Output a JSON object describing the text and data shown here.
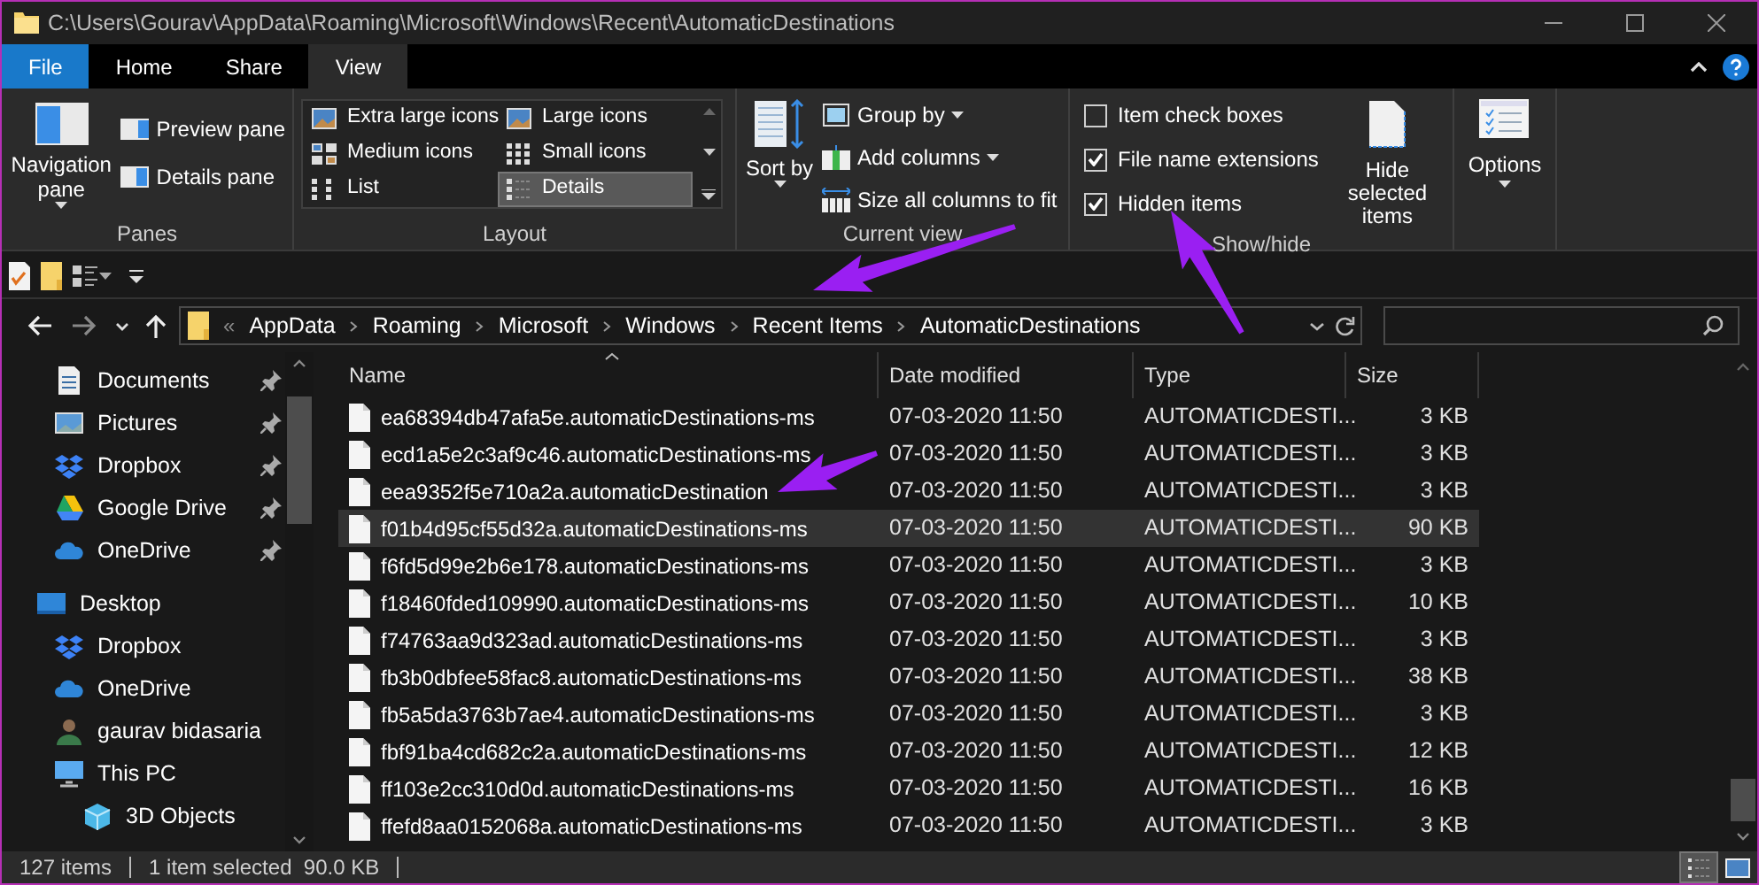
{
  "window": {
    "title": "C:\\Users\\Gourav\\AppData\\Roaming\\Microsoft\\Windows\\Recent\\AutomaticDestinations"
  },
  "tabs": [
    {
      "label": "File",
      "kind": "file",
      "selected": false
    },
    {
      "label": "Home",
      "kind": "tab",
      "selected": false
    },
    {
      "label": "Share",
      "kind": "tab",
      "selected": false
    },
    {
      "label": "View",
      "kind": "tab",
      "selected": true
    }
  ],
  "ribbon": {
    "panes": {
      "label": "Panes",
      "navigation_pane": "Navigation pane",
      "buttons": [
        "Preview pane",
        "Details pane"
      ]
    },
    "layout": {
      "label": "Layout",
      "options": [
        {
          "label": "Extra large icons",
          "kind": "xl",
          "selected": false
        },
        {
          "label": "Large icons",
          "kind": "large",
          "selected": false
        },
        {
          "label": "Medium icons",
          "kind": "medium",
          "selected": false
        },
        {
          "label": "Small icons",
          "kind": "small",
          "selected": false
        },
        {
          "label": "List",
          "kind": "list",
          "selected": false
        },
        {
          "label": "Details",
          "kind": "details",
          "selected": true
        }
      ]
    },
    "current_view": {
      "label": "Current view",
      "sort_by": "Sort by",
      "buttons": [
        {
          "label": "Group by",
          "kind": "dropdown"
        },
        {
          "label": "Add columns",
          "kind": "dropdown"
        },
        {
          "label": "Size all columns to fit",
          "kind": "plain"
        }
      ]
    },
    "show_hide": {
      "label": "Show/hide",
      "checkboxes": [
        {
          "label": "Item check boxes",
          "checked": false
        },
        {
          "label": "File name extensions",
          "checked": true
        },
        {
          "label": "Hidden items",
          "checked": true
        }
      ],
      "hide_selected": "Hide selected items"
    },
    "options": {
      "label": "Options"
    }
  },
  "address_bar": {
    "overflow": "«",
    "crumbs": [
      "AppData",
      "Roaming",
      "Microsoft",
      "Windows",
      "Recent Items",
      "AutomaticDestinations"
    ]
  },
  "nav_pane": {
    "quick_access": [
      {
        "label": "Documents",
        "kind": "documents",
        "pinned": true
      },
      {
        "label": "Pictures",
        "kind": "pictures",
        "pinned": true
      },
      {
        "label": "Dropbox",
        "kind": "dropbox",
        "pinned": true
      },
      {
        "label": "Google Drive",
        "kind": "gdrive",
        "pinned": true
      },
      {
        "label": "OneDrive",
        "kind": "onedrive",
        "pinned": true
      }
    ],
    "tree": [
      {
        "label": "Desktop",
        "kind": "desktop",
        "children": [
          {
            "label": "Dropbox",
            "kind": "dropbox"
          },
          {
            "label": "OneDrive",
            "kind": "onedrive"
          },
          {
            "label": "gaurav bidasaria",
            "kind": "user"
          },
          {
            "label": "This PC",
            "kind": "pc",
            "children": [
              {
                "label": "3D Objects",
                "kind": "objects3d"
              }
            ]
          }
        ]
      }
    ]
  },
  "table": {
    "columns": [
      "Name",
      "Date modified",
      "Type",
      "Size"
    ],
    "rows": [
      {
        "name": "ea68394db47afa5e.automaticDestinations-ms",
        "date": "07-03-2020 11:50",
        "type": "AUTOMATICDESTI...",
        "size": "3 KB",
        "selected": false
      },
      {
        "name": "ecd1a5e2c3af9c46.automaticDestinations-ms",
        "date": "07-03-2020 11:50",
        "type": "AUTOMATICDESTI...",
        "size": "3 KB",
        "selected": false
      },
      {
        "name": "eea9352f5e710a2a.automaticDestination",
        "date": "07-03-2020 11:50",
        "type": "AUTOMATICDESTI...",
        "size": "3 KB",
        "selected": false
      },
      {
        "name": "f01b4d95cf55d32a.automaticDestinations-ms",
        "date": "07-03-2020 11:50",
        "type": "AUTOMATICDESTI...",
        "size": "90 KB",
        "selected": true
      },
      {
        "name": "f6fd5d99e2b6e178.automaticDestinations-ms",
        "date": "07-03-2020 11:50",
        "type": "AUTOMATICDESTI...",
        "size": "3 KB",
        "selected": false
      },
      {
        "name": "f18460fded109990.automaticDestinations-ms",
        "date": "07-03-2020 11:50",
        "type": "AUTOMATICDESTI...",
        "size": "10 KB",
        "selected": false
      },
      {
        "name": "f74763aa9d323ad.automaticDestinations-ms",
        "date": "07-03-2020 11:50",
        "type": "AUTOMATICDESTI...",
        "size": "3 KB",
        "selected": false
      },
      {
        "name": "fb3b0dbfee58fac8.automaticDestinations-ms",
        "date": "07-03-2020 11:50",
        "type": "AUTOMATICDESTI...",
        "size": "38 KB",
        "selected": false
      },
      {
        "name": "fb5a5da3763b7ae4.automaticDestinations-ms",
        "date": "07-03-2020 11:50",
        "type": "AUTOMATICDESTI...",
        "size": "3 KB",
        "selected": false
      },
      {
        "name": "fbf91ba4cd682c2a.automaticDestinations-ms",
        "date": "07-03-2020 11:50",
        "type": "AUTOMATICDESTI...",
        "size": "12 KB",
        "selected": false
      },
      {
        "name": "ff103e2cc310d0d.automaticDestinations-ms",
        "date": "07-03-2020 11:50",
        "type": "AUTOMATICDESTI...",
        "size": "16 KB",
        "selected": false
      },
      {
        "name": "ffefd8aa0152068a.automaticDestinations-ms",
        "date": "07-03-2020 11:50",
        "type": "AUTOMATICDESTI...",
        "size": "3 KB",
        "selected": false
      }
    ]
  },
  "status_bar": {
    "item_count": "127 items",
    "selection": "1 item selected  90.0 KB",
    "view_buttons": [
      {
        "kind": "details",
        "selected": true
      },
      {
        "kind": "large",
        "selected": false
      }
    ]
  }
}
